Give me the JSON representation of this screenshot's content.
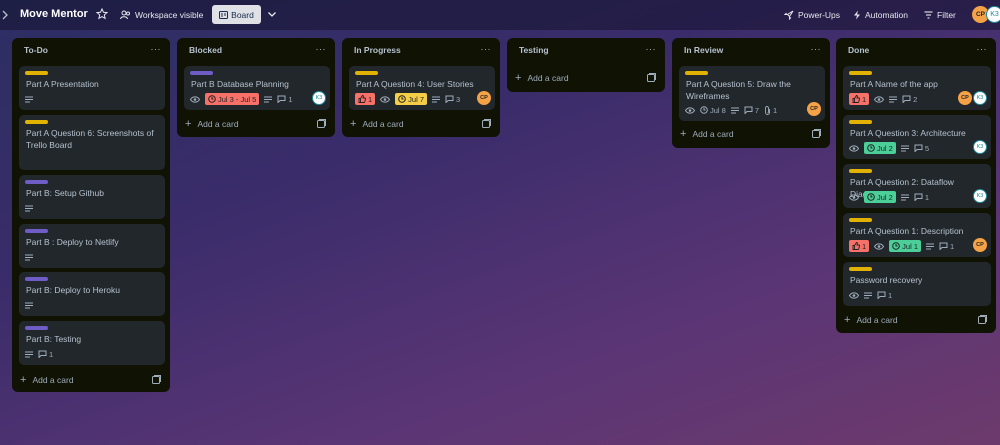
{
  "header": {
    "board_title": "Move Mentor",
    "visibility": "Workspace visible",
    "view": "Board",
    "power_ups": "Power-Ups",
    "automation": "Automation",
    "filter": "Filter",
    "members": [
      "CP",
      "K3"
    ]
  },
  "lists": [
    {
      "title": "To-Do",
      "add_card": "Add a card",
      "cards": [
        {
          "title": "Part A Presentation",
          "label": "yellow"
        },
        {
          "title": "Part A Question 6: Screenshots of Trello Board",
          "label": "yellow"
        },
        {
          "title": "Part B: Setup Github",
          "label": "purple"
        },
        {
          "title": "Part B : Deploy to Netlify",
          "label": "purple"
        },
        {
          "title": "Part B: Deploy to Heroku",
          "label": "purple"
        },
        {
          "title": "Part B: Testing",
          "label": "purple",
          "comments": "1"
        }
      ]
    },
    {
      "title": "Blocked",
      "add_card": "Add a card",
      "cards": [
        {
          "title": "Part B Database Planning",
          "label": "purple",
          "dates": "Jul 3 - Jul 5",
          "comments": "1",
          "member": "K3"
        }
      ]
    },
    {
      "title": "In Progress",
      "add_card": "Add a card",
      "cards": [
        {
          "title": "Part A Question 4: User Stories",
          "label": "yellow",
          "votes": "1",
          "due": "Jul 7",
          "comments": "3",
          "member": "CP"
        }
      ]
    },
    {
      "title": "Testing",
      "add_card": "Add a card",
      "cards": []
    },
    {
      "title": "In Review",
      "add_card": "Add a card",
      "cards": [
        {
          "title": "Part A Question 5: Draw the Wireframes",
          "label": "yellow",
          "due": "Jul 8",
          "comments": "7",
          "attachments": "1",
          "member": "CP"
        }
      ]
    },
    {
      "title": "Done",
      "add_card": "Add a card",
      "cards": [
        {
          "title": "Part A Name of the app",
          "label": "yellow",
          "votes": "1",
          "comments": "2",
          "members": [
            "CP",
            "K3"
          ]
        },
        {
          "title": "Part A Question 3: Architecture",
          "label": "yellow",
          "due": "Jul 2",
          "comments": "5",
          "member": "K3"
        },
        {
          "title": "Part A Question 2: Dataflow Diagram",
          "label": "yellow",
          "due": "Jul 2",
          "comments": "1",
          "member": "K3"
        },
        {
          "title": "Part A Question 1: Description",
          "label": "yellow",
          "votes": "1",
          "due": "Jul 1",
          "comments": "1",
          "member": "CP"
        },
        {
          "title": "Password recovery",
          "label": "yellow",
          "comments": "1"
        }
      ]
    }
  ],
  "colors": {
    "label_yellow": "#e2b203",
    "label_purple": "#6e5dc6",
    "chip_red": "#f87168",
    "chip_yellow": "#f5cd47",
    "chip_green": "#4bce97",
    "avatar_cp": "#f5a246"
  }
}
